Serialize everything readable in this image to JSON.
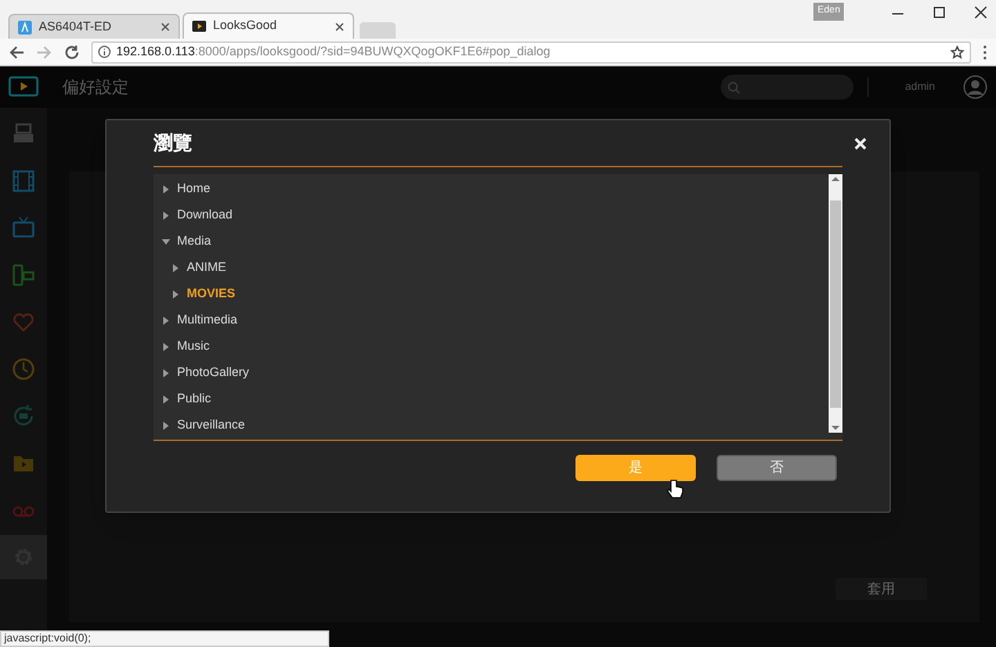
{
  "browser": {
    "profile": "Eden",
    "tabs": [
      {
        "label": "AS6404T-ED",
        "selected": false
      },
      {
        "label": "LooksGood",
        "selected": true
      }
    ],
    "url_host": "192.168.0.113",
    "url_rest": ":8000/apps/looksgood/?sid=94BUWQXQogOKF1E6#pop_dialog",
    "status": "javascript:void(0);"
  },
  "app": {
    "title": "偏好設定",
    "user": "admin",
    "apply_button": "套用"
  },
  "sidebar": [
    {
      "kind": "nas",
      "selected": false
    },
    {
      "kind": "film",
      "selected": false
    },
    {
      "kind": "tv",
      "selected": false
    },
    {
      "kind": "remote",
      "selected": false
    },
    {
      "kind": "heart",
      "selected": false
    },
    {
      "kind": "clock",
      "selected": false
    },
    {
      "kind": "replay",
      "selected": false
    },
    {
      "kind": "folder",
      "selected": false
    },
    {
      "kind": "tape",
      "selected": false
    },
    {
      "kind": "gear",
      "selected": true
    }
  ],
  "dialog": {
    "title": "瀏覽",
    "tree": [
      {
        "label": "Home",
        "expanded": false,
        "selected": false
      },
      {
        "label": "Download",
        "expanded": false,
        "selected": false
      },
      {
        "label": "Media",
        "expanded": true,
        "selected": false,
        "children": [
          {
            "label": "ANIME",
            "expanded": false,
            "selected": false
          },
          {
            "label": "MOVIES",
            "expanded": false,
            "selected": true
          }
        ]
      },
      {
        "label": "Multimedia",
        "expanded": false,
        "selected": false
      },
      {
        "label": "Music",
        "expanded": false,
        "selected": false
      },
      {
        "label": "PhotoGallery",
        "expanded": false,
        "selected": false
      },
      {
        "label": "Public",
        "expanded": false,
        "selected": false
      },
      {
        "label": "Surveillance",
        "expanded": false,
        "selected": false
      }
    ],
    "ok_button": "是",
    "cancel_button": "否"
  }
}
